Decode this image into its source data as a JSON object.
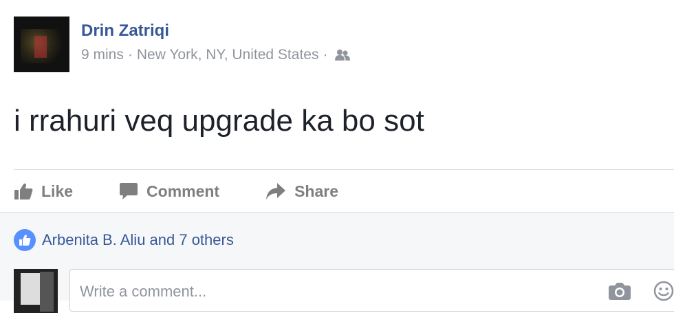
{
  "post": {
    "author": "Drin Zatriqi",
    "time": "9 mins",
    "location": "New York, NY, United States",
    "separator": "·",
    "audience_icon": "friends-icon",
    "text": "i rrahuri veq upgrade ka bo sot"
  },
  "actions": {
    "like_label": "Like",
    "comment_label": "Comment",
    "share_label": "Share"
  },
  "feedback": {
    "likes_text": "Arbenita B. Aliu and 7 others",
    "comment_placeholder": "Write a comment..."
  },
  "colors": {
    "link_blue": "#365899",
    "muted_gray": "#90949c",
    "action_gray": "#7f7f7f",
    "like_badge": "#5890ff",
    "feedback_bg": "#f6f7f9"
  }
}
